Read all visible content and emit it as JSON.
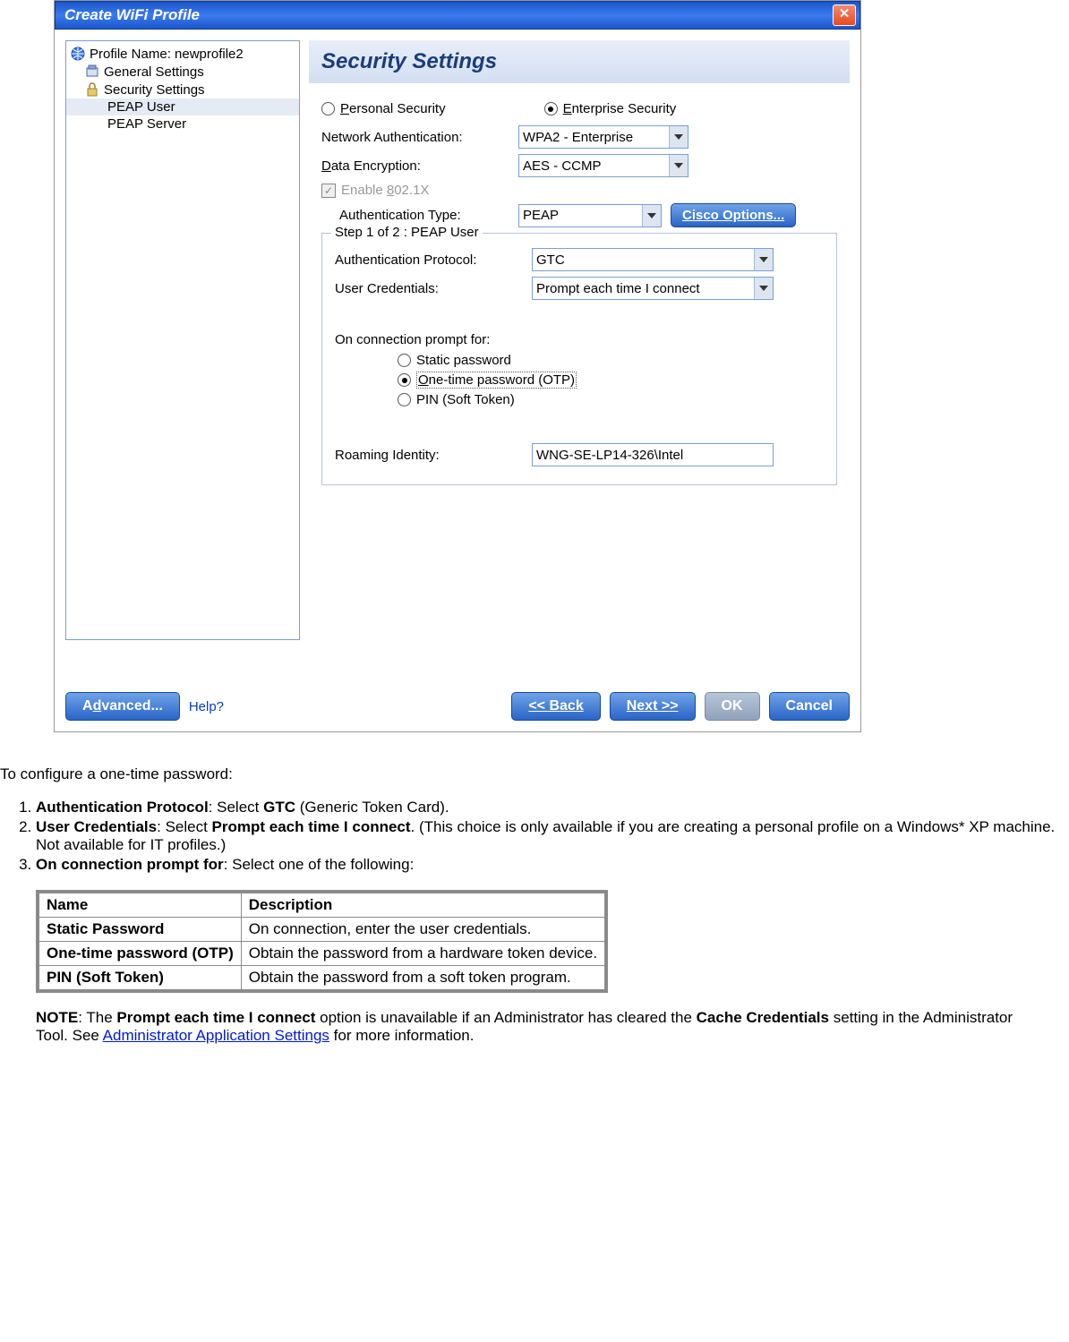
{
  "dialog": {
    "title": "Create WiFi Profile",
    "tree": {
      "profile_label": "Profile Name: newprofile2",
      "general": "General Settings",
      "security": "Security Settings",
      "peap_user": "PEAP User",
      "peap_server": "PEAP Server"
    },
    "heading": "Security Settings",
    "radios": {
      "personal": "Personal Security",
      "enterprise": "Enterprise Security"
    },
    "labels": {
      "net_auth": "Network Authentication:",
      "data_enc": "Data Encryption:",
      "enable_8021x": "Enable 802.1X",
      "auth_type": "Authentication Type:",
      "auth_proto": "Authentication Protocol:",
      "user_cred": "User Credentials:",
      "on_conn": "On connection prompt for:",
      "roaming": "Roaming Identity:",
      "step_title": "Step 1 of 2 : PEAP User"
    },
    "values": {
      "net_auth": "WPA2 - Enterprise",
      "data_enc": "AES - CCMP",
      "auth_type": "PEAP",
      "auth_proto": "GTC",
      "user_cred": "Prompt each time I connect",
      "roaming": "WNG-SE-LP14-326\\Intel"
    },
    "cisco_btn": "Cisco Options...",
    "prompt_opts": {
      "static": "Static password",
      "otp": "One-time password (OTP)",
      "pin": "PIN (Soft Token)"
    },
    "buttons": {
      "advanced": "Advanced...",
      "help": "Help?",
      "back": "<< Back",
      "next": "Next >>",
      "ok": "OK",
      "cancel": "Cancel"
    }
  },
  "doc": {
    "intro": "To configure a one-time password:",
    "steps": {
      "s1a": "Authentication Protocol",
      "s1b": ": Select ",
      "s1c": "GTC",
      "s1d": " (Generic Token Card).",
      "s2a": "User Credentials",
      "s2b": ": Select ",
      "s2c": "Prompt each time I connect",
      "s2d": ". (This choice is only available if you are creating a personal profile on a Windows* XP machine. Not available for IT profiles.)",
      "s3a": "On connection prompt for",
      "s3b": ": Select one of the following:"
    },
    "table": {
      "h1": "Name",
      "h2": "Description",
      "r1c1": "Static Password",
      "r1c2": "On connection, enter the user credentials.",
      "r2c1": "One-time password (OTP)",
      "r2c2": "Obtain the password from a hardware token device.",
      "r3c1": "PIN (Soft Token)",
      "r3c2": "Obtain the password from a soft token program."
    },
    "note": {
      "l": "NOTE",
      "t1": ": The ",
      "b1": "Prompt each time I connect",
      "t2": " option is unavailable if an Administrator has cleared the ",
      "b2": "Cache Credentials",
      "t3": " setting in the Administrator Tool. See ",
      "link": "Administrator Application Settings",
      "t4": " for more information."
    }
  }
}
